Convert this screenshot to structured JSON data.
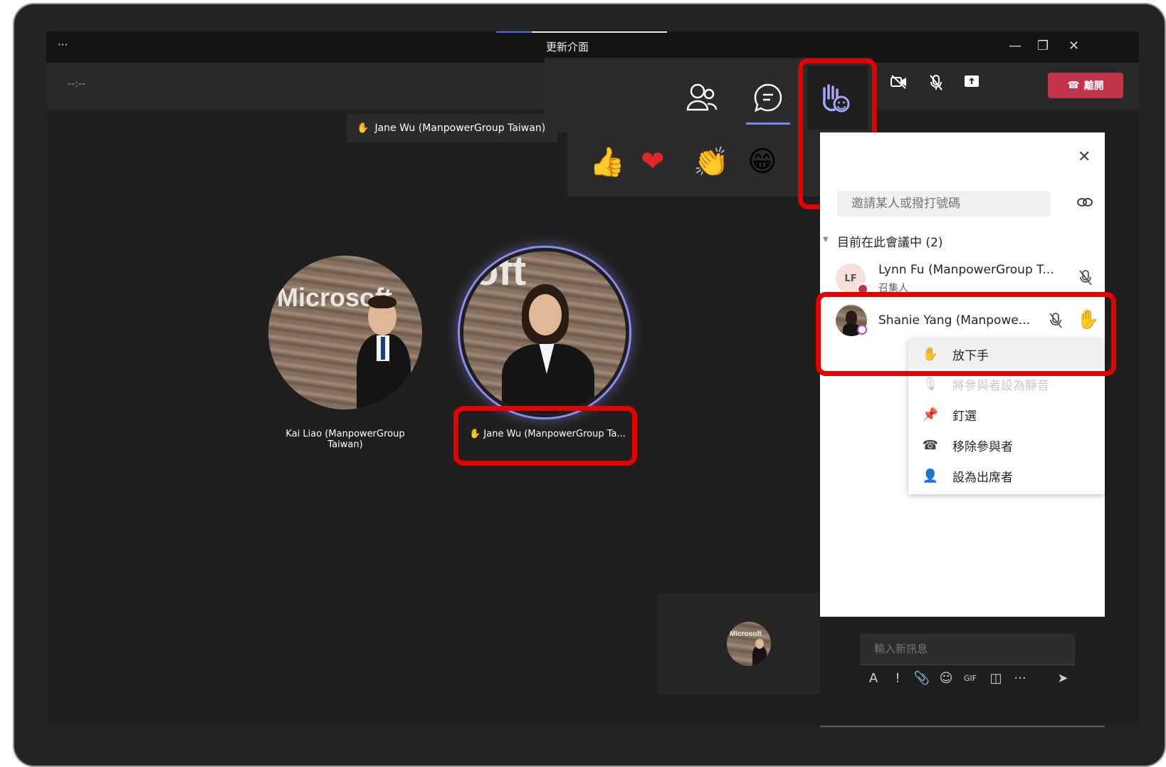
{
  "titlebar": {
    "more": "···",
    "title": "更新介面"
  },
  "meeting": {
    "timer": "--:--",
    "leave_label": "離開"
  },
  "tooltip": {
    "hand": "✋",
    "text": "Jane Wu (ManpowerGroup Taiwan)"
  },
  "participants_stage": [
    {
      "name": "Kai Liao (ManpowerGroup Taiwan)"
    },
    {
      "name": "Jane Wu (ManpowerGroup Ta...",
      "hand": "✋"
    }
  ],
  "photo_text": {
    "left": "Microsoft",
    "right": "oft",
    "self": "Microsoft"
  },
  "reactions": {
    "emojis": [
      "👍",
      "❤",
      "👏",
      "😁",
      "✋"
    ]
  },
  "panel": {
    "close": "✕",
    "invite_placeholder": "邀請某人或撥打號碼",
    "section_label": "目前在此會議中 (2)",
    "people": [
      {
        "initials": "LF",
        "name": "Lynn Fu (ManpowerGroup T...",
        "role": "召集人"
      },
      {
        "name": "Shanie Yang (Manpowe..."
      }
    ],
    "menu": [
      {
        "icon": "✋",
        "label": "放下手"
      },
      {
        "icon": "🎙",
        "label": "將參與者設為靜音",
        "disabled": true
      },
      {
        "icon": "📌",
        "label": "釘選"
      },
      {
        "icon": "☎",
        "label": "移除參與者"
      },
      {
        "icon": "👤",
        "label": "設為出席者"
      }
    ]
  },
  "chat": {
    "placeholder": "輸入新訊息",
    "toolbar": [
      "A",
      "!",
      "📎",
      "☺",
      "GIF",
      "◫",
      "···",
      "➤"
    ]
  },
  "colors": {
    "accent": "#4f6bed",
    "leave": "#c4314b",
    "highlight": "#e50000",
    "hand": "#f5a623"
  }
}
